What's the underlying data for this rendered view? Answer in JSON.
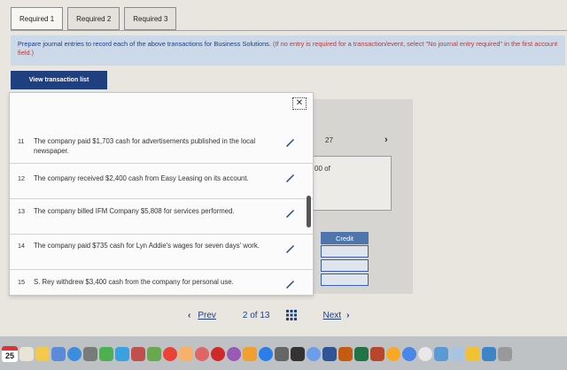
{
  "tabs": [
    {
      "label": "Required 1",
      "active": true
    },
    {
      "label": "Required 2",
      "active": false
    },
    {
      "label": "Required 3",
      "active": false
    }
  ],
  "instructions": {
    "main": "Prepare journal entries to record each of the above transactions for Business Solutions.",
    "note": "(If no entry is required for a transaction/event, select \"No journal entry required\" in the first account field.)"
  },
  "view_button": "View transaction list",
  "popup": {
    "close": "✕",
    "items": [
      {
        "num": "11",
        "text": "The company paid $1,703 cash for advertisements published in the local newspaper."
      },
      {
        "num": "12",
        "text": "The company received $2,400 cash from Easy Leasing on its account."
      },
      {
        "num": "13",
        "text": "The company billed IFM Company $5,808 for services performed."
      },
      {
        "num": "14",
        "text": "The company paid $735 cash for Lyn Addie's wages for seven days' work."
      },
      {
        "num": "15",
        "text": "S. Rey withdrew $3,400 cash from the company for personal use."
      }
    ]
  },
  "background": {
    "num": "27",
    "frag": "00 of",
    "credit_header": "Credit"
  },
  "nav": {
    "prev": "Prev",
    "page": "2 of 13",
    "next": "Next"
  },
  "dock": {
    "calendar_day": "25"
  },
  "colors": {
    "accent": "#1f3f7f",
    "instruction_bg": "#cbd9e8",
    "credit_header": "#4e76ad"
  }
}
